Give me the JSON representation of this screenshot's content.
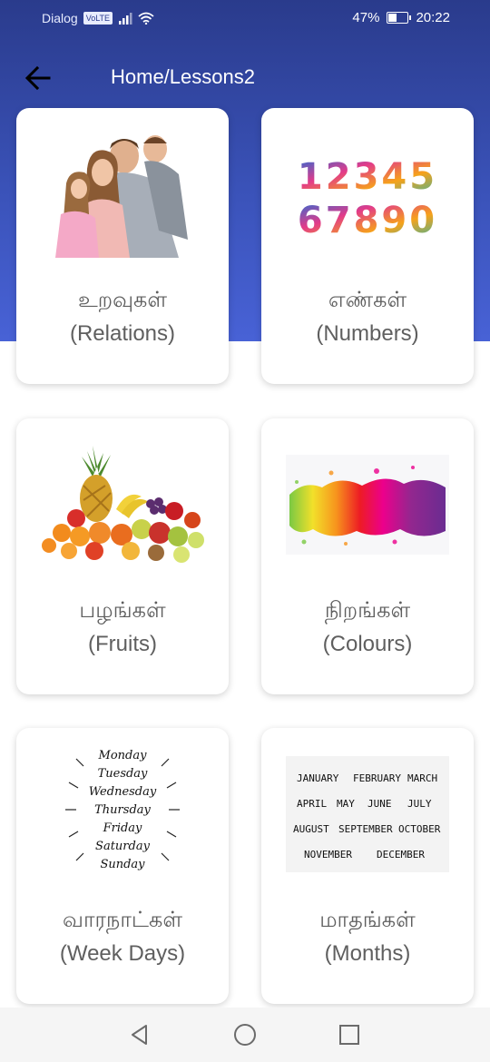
{
  "status": {
    "carrier": "Dialog",
    "volte": "VoLTE",
    "battery_percent": "47%",
    "battery_level": 0.47,
    "time": "20:22"
  },
  "header": {
    "title": "Home/Lessons2",
    "back_icon": "arrow-left-icon"
  },
  "lessons": [
    {
      "tamil": "உறவுகள்",
      "english": "(Relations)",
      "image": "family-photo"
    },
    {
      "tamil": "எண்கள்",
      "english": "(Numbers)",
      "image": "colorful-digits"
    },
    {
      "tamil": "பழங்கள்",
      "english": "(Fruits)",
      "image": "fruit-pile"
    },
    {
      "tamil": "நிறங்கள்",
      "english": "(Colours)",
      "image": "paint-splash"
    },
    {
      "tamil": "வாரநாட்கள்",
      "english": "(Week Days)",
      "image": "weekday-lettering"
    },
    {
      "tamil": "மாதங்கள்",
      "english": "(Months)",
      "image": "month-lettering"
    }
  ],
  "image_text": {
    "digits_row1": "12345",
    "digits_row2": "67890",
    "weekdays": [
      "Monday",
      "Tuesday",
      "Wednesday",
      "Thursday",
      "Friday",
      "Saturday",
      "Sunday"
    ],
    "months": [
      [
        "JANUARY",
        "FEBRUARY",
        "MARCH"
      ],
      [
        "APRIL",
        "MAY",
        "JUNE",
        "JULY"
      ],
      [
        "AUGUST",
        "SEPTEMBER",
        "OCTOBER"
      ],
      [
        "NOVEMBER",
        "DECEMBER"
      ]
    ]
  },
  "nav": {
    "back": "triangle-back-icon",
    "home": "circle-home-icon",
    "recents": "square-recents-icon"
  },
  "colors": {
    "header": "#2a3b8c",
    "hero_bottom": "#4862d6",
    "card_text": "#5f5f5f"
  }
}
